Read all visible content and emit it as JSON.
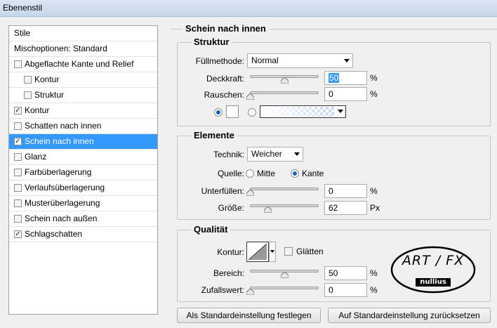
{
  "window": {
    "title": "Ebenenstil"
  },
  "sidebar": {
    "items": [
      {
        "label": "Stile",
        "check": false,
        "checked": false
      },
      {
        "label": "Mischoptionen: Standard",
        "check": false,
        "checked": false
      },
      {
        "label": "Abgeflachte Kante und Relief",
        "check": true,
        "checked": false
      },
      {
        "label": "Kontur",
        "check": true,
        "checked": false,
        "sub": true
      },
      {
        "label": "Struktur",
        "check": true,
        "checked": false,
        "sub": true
      },
      {
        "label": "Kontur",
        "check": true,
        "checked": true
      },
      {
        "label": "Schatten nach innen",
        "check": true,
        "checked": false
      },
      {
        "label": "Schein nach innen",
        "check": true,
        "checked": true,
        "selected": true
      },
      {
        "label": "Glanz",
        "check": true,
        "checked": false
      },
      {
        "label": "Farbüberlagerung",
        "check": true,
        "checked": false
      },
      {
        "label": "Verlaufsüberlagerung",
        "check": true,
        "checked": false
      },
      {
        "label": "Musterüberlagerung",
        "check": true,
        "checked": false
      },
      {
        "label": "Schein nach außen",
        "check": true,
        "checked": false
      },
      {
        "label": "Schlagschatten",
        "check": true,
        "checked": true
      }
    ]
  },
  "panel": {
    "title": "Schein nach innen",
    "struktur": {
      "title": "Struktur",
      "fuellmethode_label": "Füllmethode:",
      "fuellmethode_value": "Normal",
      "deckkraft_label": "Deckkraft:",
      "deckkraft_value": "50",
      "deckkraft_level": 0.5,
      "rauschen_label": "Rauschen:",
      "rauschen_value": "0",
      "rauschen_level": 0,
      "percent": "%"
    },
    "elemente": {
      "title": "Elemente",
      "technik_label": "Technik:",
      "technik_value": "Weicher",
      "quelle_label": "Quelle:",
      "quelle_mitte": "Mitte",
      "quelle_kante": "Kante",
      "unterfuellen_label": "Unterfüllen:",
      "unterfuellen_value": "0",
      "unterfuellen_level": 0,
      "groesse_label": "Größe:",
      "groesse_value": "62",
      "groesse_level": 0.25,
      "percent": "%",
      "px": "Px"
    },
    "qualitaet": {
      "title": "Qualität",
      "kontur_label": "Kontur:",
      "glaetten_label": "Glätten",
      "bereich_label": "Bereich:",
      "bereich_value": "50",
      "bereich_level": 0.5,
      "zufallswert_label": "Zufallswert:",
      "zufallswert_value": "0",
      "zufallswert_level": 0,
      "percent": "%"
    },
    "buttons": {
      "default_set": "Als Standardeinstellung festlegen",
      "default_reset": "Auf Standardeinstellung zurücksetzen"
    },
    "logo": {
      "line1": "ART / FX",
      "line2": "nullius"
    }
  }
}
